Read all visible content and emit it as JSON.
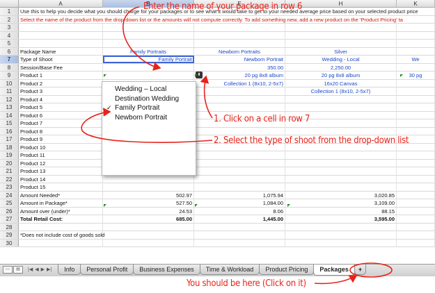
{
  "columns": [
    "A",
    "B",
    "E",
    "H",
    "K"
  ],
  "selected_column": "B",
  "rows": [
    {
      "num": "1",
      "text": "Use this to help you decide what you should charge for your packages or to see what it would take to get to your needed average price based on your selected product price",
      "style": "info"
    },
    {
      "num": "2",
      "text": "Select the name of the product from the drop-down list or the amounts will not compute correctly. To add something new, add a new product on the 'Product Pricing' ta",
      "style": "red"
    },
    {
      "num": "3",
      "cells": [
        "",
        "",
        "",
        "",
        ""
      ]
    },
    {
      "num": "4",
      "cells": [
        "",
        "",
        "",
        "",
        ""
      ]
    },
    {
      "num": "5",
      "cells": [
        "",
        "",
        "",
        "",
        ""
      ]
    },
    {
      "num": "6",
      "cells": [
        "Package Name",
        "Family Portraits",
        "Newborn Portraits",
        "Silver",
        ""
      ],
      "style": "header"
    },
    {
      "num": "7",
      "cells": [
        "Type of Shoot",
        "Family Portrait",
        "Newborn Portrait",
        "Wedding - Local",
        "We"
      ],
      "style": "blue"
    },
    {
      "num": "8",
      "cells": [
        "Session/Base Fee",
        "",
        "350.00",
        "2,250.00",
        ""
      ],
      "style": "blue"
    },
    {
      "num": "9",
      "cells": [
        "Product 1",
        "",
        "20 pg 8x8 album",
        "20 pg 8x8 album",
        "30 pg"
      ],
      "style": "blue"
    },
    {
      "num": "10",
      "cells": [
        "Product 2",
        "",
        "Collection 1 (8x10, 2-5x7)",
        "16x20 Canvas",
        ""
      ],
      "style": "blue"
    },
    {
      "num": "11",
      "cells": [
        "Product 3",
        "",
        "",
        "Collection 1 (8x10, 2-5x7)",
        ""
      ],
      "style": "blue"
    },
    {
      "num": "12",
      "cells": [
        "Product 4",
        "",
        "",
        "",
        ""
      ]
    },
    {
      "num": "13",
      "cells": [
        "Product 5",
        "",
        "",
        "",
        ""
      ]
    },
    {
      "num": "14",
      "cells": [
        "Product 6",
        "",
        "",
        "",
        ""
      ]
    },
    {
      "num": "15",
      "cells": [
        "Product 7",
        "",
        "",
        "",
        ""
      ]
    },
    {
      "num": "16",
      "cells": [
        "Product 8",
        "",
        "",
        "",
        ""
      ]
    },
    {
      "num": "17",
      "cells": [
        "Product 9",
        "",
        "",
        "",
        ""
      ]
    },
    {
      "num": "18",
      "cells": [
        "Product 10",
        "",
        "",
        "",
        ""
      ]
    },
    {
      "num": "19",
      "cells": [
        "Product 11",
        "",
        "",
        "",
        ""
      ]
    },
    {
      "num": "20",
      "cells": [
        "Product 12",
        "",
        "",
        "",
        ""
      ]
    },
    {
      "num": "21",
      "cells": [
        "Product 13",
        "",
        "",
        "",
        ""
      ]
    },
    {
      "num": "22",
      "cells": [
        "Product 14",
        "",
        "",
        "",
        ""
      ]
    },
    {
      "num": "23",
      "cells": [
        "Product 15",
        "",
        "",
        "",
        ""
      ]
    },
    {
      "num": "24",
      "cells": [
        "Amount Needed*",
        "502.97",
        "1,075.94",
        "3,020.85",
        ""
      ],
      "style": "num"
    },
    {
      "num": "25",
      "cells": [
        "Amount in Package*",
        "527.50",
        "1,084.00",
        "3,109.00",
        ""
      ],
      "style": "num"
    },
    {
      "num": "26",
      "cells": [
        "Amount over (under)*",
        "24.53",
        "8.06",
        "88.15",
        ""
      ],
      "style": "num"
    },
    {
      "num": "27",
      "cells": [
        "Total Retail Cost:",
        "685.00",
        "1,445.00",
        "3,595.00",
        ""
      ],
      "style": "total"
    },
    {
      "num": "28",
      "cells": [
        "",
        "",
        "",
        "",
        ""
      ]
    },
    {
      "num": "29",
      "cells": [
        "*Does not include cost of goods sold",
        "",
        "",
        "",
        ""
      ],
      "style": "note"
    },
    {
      "num": "30",
      "cells": [
        "",
        "",
        "",
        "",
        ""
      ]
    }
  ],
  "dropdown": {
    "options": [
      "Wedding – Local",
      "Destination Wedding",
      "Family Portrait",
      "Newborn Portrait"
    ],
    "checked_index": 2
  },
  "tabs": [
    {
      "label": "Info",
      "active": false
    },
    {
      "label": "Personal Profit",
      "active": false
    },
    {
      "label": "Business Expenses",
      "active": false
    },
    {
      "label": "Time & Workload",
      "active": false
    },
    {
      "label": "Product Pricing",
      "active": false
    },
    {
      "label": "Packages",
      "active": true
    },
    {
      "label": "+",
      "active": false
    }
  ],
  "annotations": {
    "top": "Enter the name of your package in row 6",
    "step1": "1. Click on a cell in row 7",
    "step2": "2. Select the type of shoot from the drop-down list",
    "bottom": "You should be here (Click on it)"
  },
  "colors": {
    "annotation": "#e8231a",
    "link_blue": "#1b46c8",
    "warning_red": "#d4180c",
    "triangle_green": "#1f8b1f"
  }
}
